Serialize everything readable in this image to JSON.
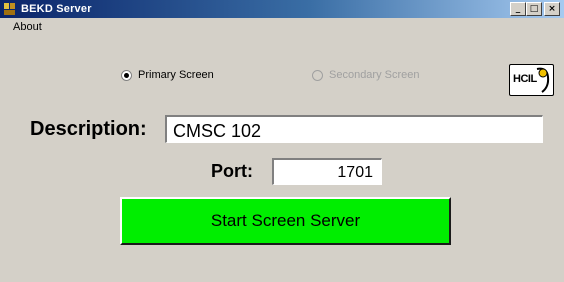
{
  "window": {
    "title": "BEKD Server",
    "min_glyph": "_",
    "max_glyph": "□",
    "close_glyph": "×"
  },
  "menu": {
    "about_label": "About"
  },
  "screen_options": {
    "primary_label": "Primary Screen",
    "primary_selected": true,
    "secondary_label": "Secondary Screen",
    "secondary_enabled": false
  },
  "logo": {
    "text": "HCIL"
  },
  "form": {
    "description_label": "Description:",
    "description_value": "CMSC 102",
    "port_label": "Port:",
    "port_value": "1701"
  },
  "actions": {
    "start_label": "Start Screen Server"
  },
  "colors": {
    "start_button_bg": "#00ee00",
    "window_bg": "#d4d0c8",
    "titlebar_start": "#0a246a"
  }
}
